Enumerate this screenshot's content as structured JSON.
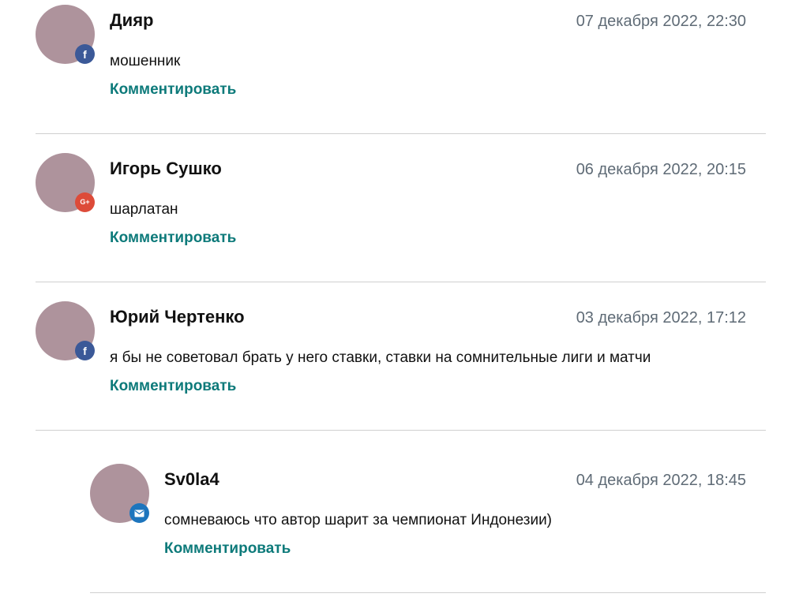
{
  "comments": [
    {
      "author": "Дияр",
      "date": "07 декабря 2022, 22:30",
      "text": "мошенник",
      "action": "Комментировать",
      "badge": "facebook-icon",
      "badge_symbol": "f"
    },
    {
      "author": "Игорь Сушко",
      "date": "06 декабря 2022, 20:15",
      "text": "шарлатан",
      "action": "Комментировать",
      "badge": "google-plus-icon",
      "badge_symbol": "G+"
    },
    {
      "author": "Юрий Чертенко",
      "date": "03 декабря 2022, 17:12",
      "text": "я бы не советовал брать у него ставки, ставки на сомнительные лиги и матчи",
      "action": "Комментировать",
      "badge": "facebook-icon",
      "badge_symbol": "f"
    },
    {
      "author": "Sv0la4",
      "date": "04 декабря 2022, 18:45",
      "text": "сомневаюсь что автор шарит за чемпионат Индонезии)",
      "action": "Комментировать",
      "badge": "mail-icon"
    }
  ],
  "colors": {
    "avatar": "#ae939c",
    "facebook": "#3b5998",
    "google_plus": "#dd4b39",
    "mail": "#1d75bd",
    "action_link": "#0d7a7a",
    "date": "#5f6b76",
    "divider": "#cfcfcf"
  }
}
